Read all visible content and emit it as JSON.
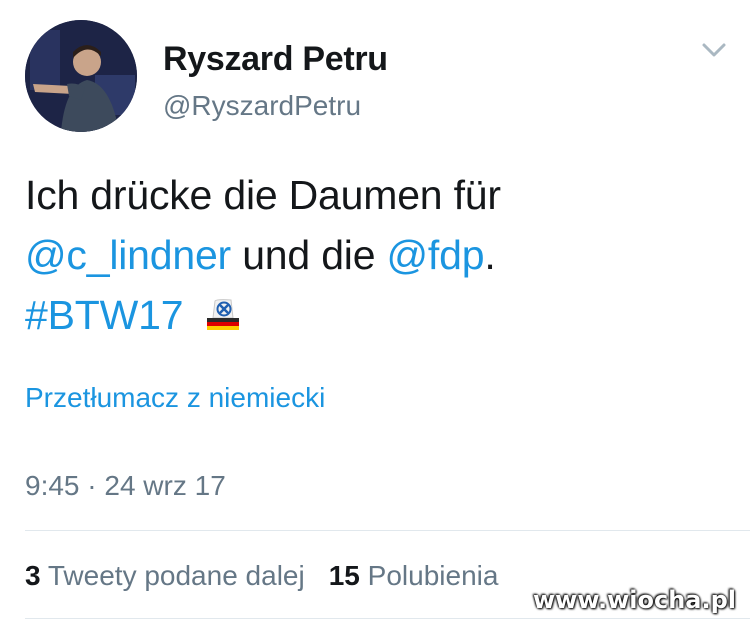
{
  "user": {
    "display_name": "Ryszard Petru",
    "handle": "@RyszardPetru"
  },
  "tweet": {
    "text_line1": "Ich drücke die Daumen für",
    "mention1": "@c_lindner",
    "text_mid": " und die ",
    "mention2": "@fdp",
    "text_end": ".",
    "hashtag": "#BTW17",
    "emoji": "ballot-box-with-german-flag-icon"
  },
  "translate_label": "Przetłumacz z niemiecki",
  "timestamp": "9:45 · 24 wrz 17",
  "stats": {
    "retweets_count": "3",
    "retweets_label": "Tweety podane dalej",
    "likes_count": "15",
    "likes_label": "Polubienia"
  },
  "watermark": "www.wiocha.pl",
  "colors": {
    "link": "#1b95e0",
    "text": "#14171a",
    "muted": "#657786",
    "divider": "#e1e8ed"
  }
}
